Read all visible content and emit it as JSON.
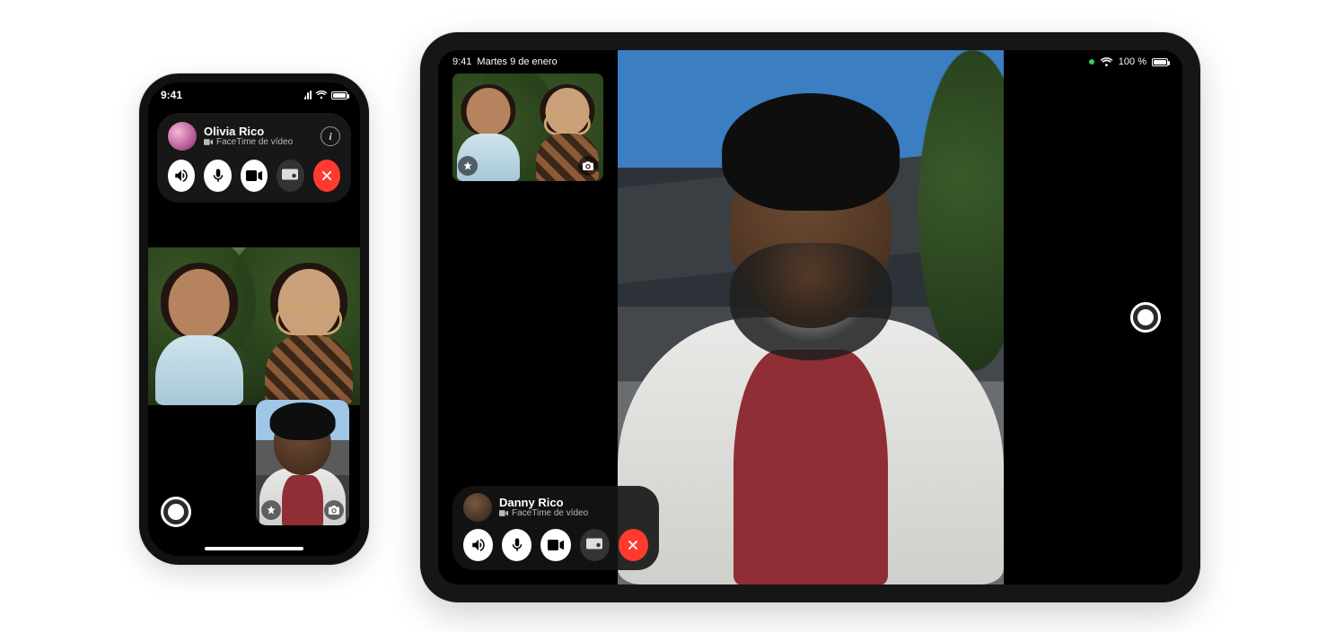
{
  "phone": {
    "status": {
      "time": "9:41"
    },
    "caller": {
      "name": "Olivia Rico",
      "subtitle": "FaceTime de vídeo"
    },
    "controls": {
      "speaker": "speaker",
      "mute": "microphone",
      "camera": "camera",
      "share": "share-screen",
      "end": "end-call"
    },
    "self_view": {
      "effects_label": "effects",
      "flip_label": "flip-camera"
    },
    "shutter_label": "live-photo"
  },
  "pad": {
    "status": {
      "time": "9:41",
      "date": "Martes 9 de enero",
      "battery_text": "100 %"
    },
    "caller": {
      "name": "Danny Rico",
      "subtitle": "FaceTime de vídeo"
    },
    "controls": {
      "speaker": "speaker",
      "mute": "microphone",
      "camera": "camera",
      "share": "share-screen",
      "end": "end-call"
    },
    "pip": {
      "effects_label": "effects",
      "flip_label": "flip-camera"
    },
    "shutter_label": "live-photo"
  },
  "colors": {
    "end_call": "#ff3b30",
    "accent_green": "#30d158"
  }
}
